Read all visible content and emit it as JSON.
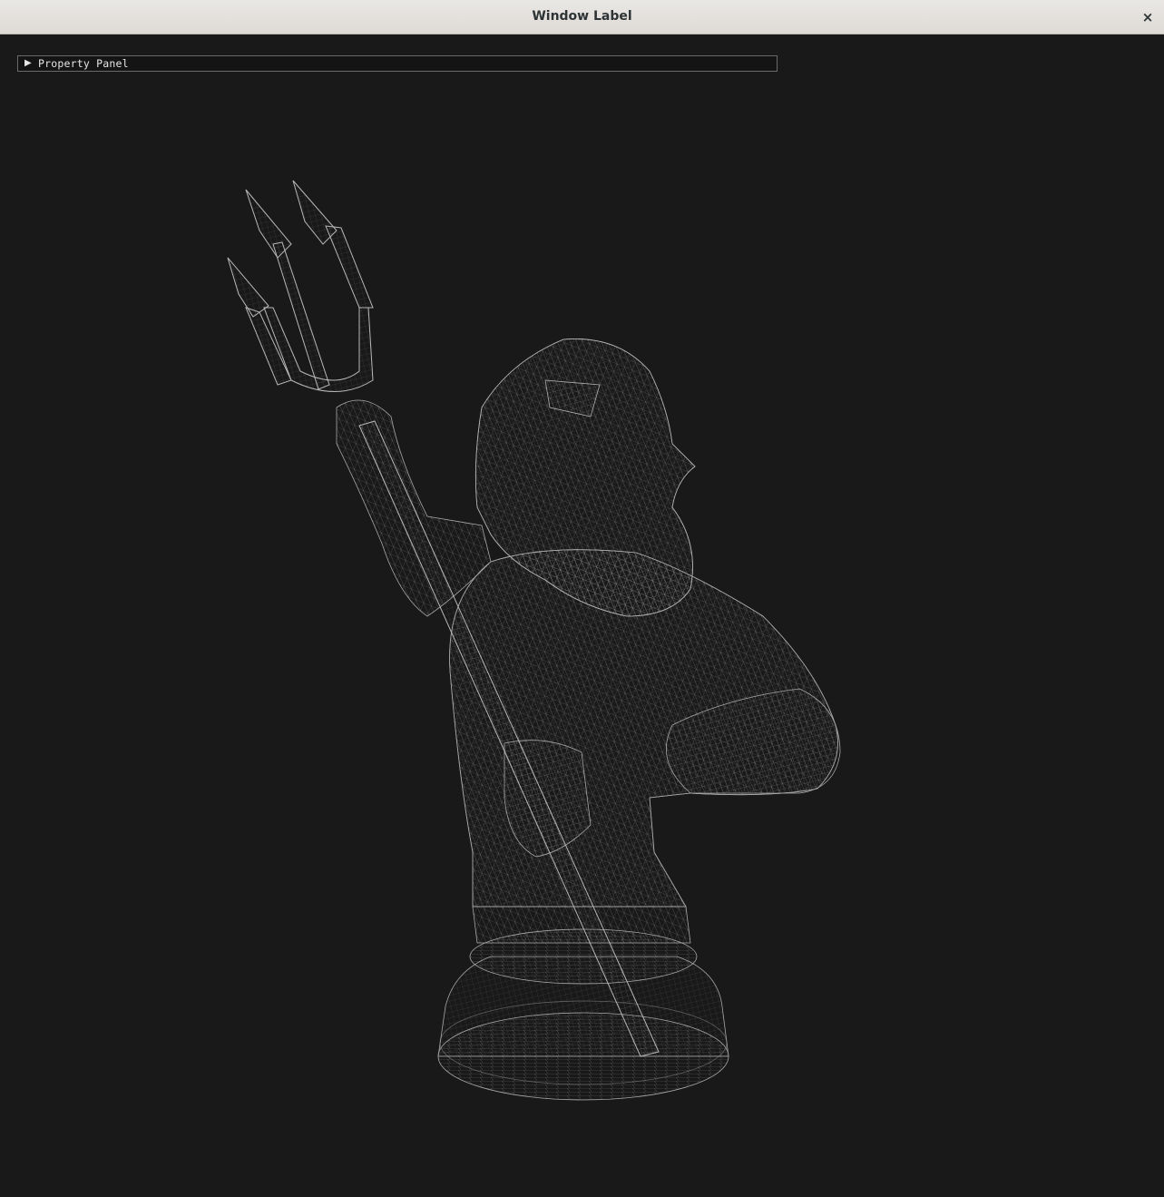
{
  "window": {
    "title": "Window Label",
    "close_symbol": "×"
  },
  "panel": {
    "arrow": "▶",
    "label": "Property Panel",
    "collapsed": true
  },
  "viewport": {
    "model": "poseidon-trident-bust",
    "render_mode": "wireframe",
    "background_color": "#191919",
    "wire_color": "#bdbdbd"
  }
}
